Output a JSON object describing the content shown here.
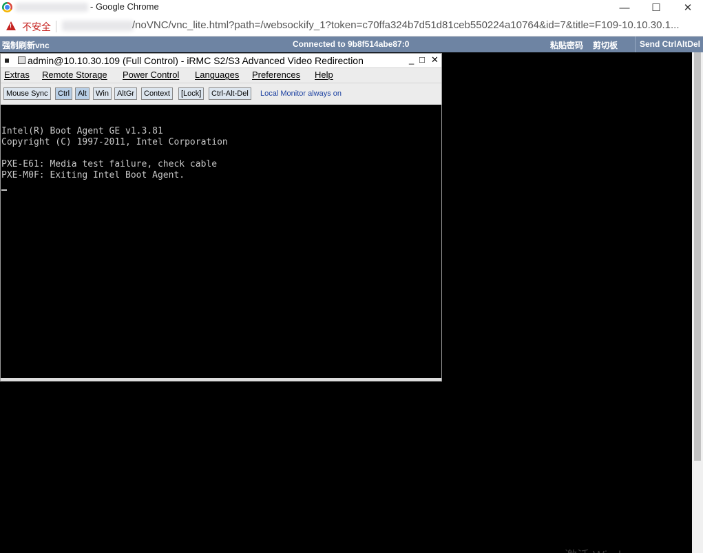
{
  "browser": {
    "window_title": "- Google Chrome",
    "controls": {
      "minimize": "—",
      "maximize": "☐",
      "close": "✕"
    },
    "security_label": "不安全",
    "url": "/noVNC/vnc_lite.html?path=/websockify_1?token=c70ffa324b7d51d81ceb550224a10764&id=7&title=F109-10.10.30.1..."
  },
  "vnc_bar": {
    "refresh_label": "强制刷新vnc",
    "status": "Connected to 9b8f514abe87:0",
    "paste_password_label": "粘贴密码",
    "clipboard_label": "剪切板",
    "send_cad_label": "Send CtrlAltDel"
  },
  "java_window": {
    "title": "admin@10.10.30.109 (Full Control) - iRMC S2/S3 Advanced Video Redirection",
    "controls": {
      "minimize": "_",
      "maximize": "□",
      "close": "✕"
    },
    "menu": [
      "Extras",
      "Remote Storage",
      "Power Control",
      "Languages",
      "Preferences",
      "Help"
    ],
    "toolbar": {
      "buttons": [
        "Mouse Sync",
        "Ctrl",
        "Alt",
        "Win",
        "AltGr",
        "Context",
        "[Lock]",
        "Ctrl-Alt-Del"
      ],
      "status_label": "Local Monitor always on"
    },
    "console_lines": [
      "Intel(R) Boot Agent GE v1.3.81",
      "Copyright (C) 1997-2011, Intel Corporation",
      "PXE-E61: Media test failure, check cable",
      "PXE-M0F: Exiting Intel Boot Agent."
    ]
  },
  "watermark": "激活 Wind"
}
